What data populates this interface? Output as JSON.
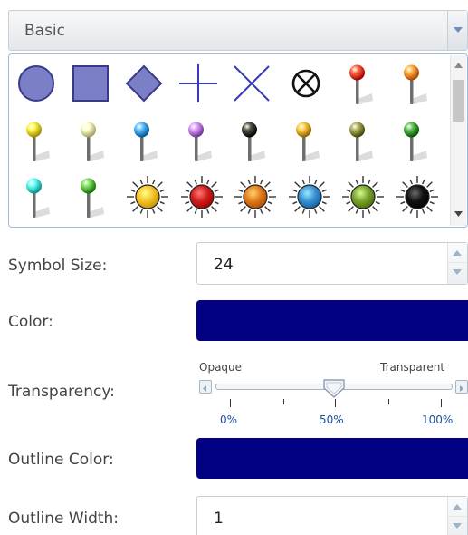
{
  "category": {
    "selected": "Basic"
  },
  "palette": {
    "symbols": [
      {
        "kind": "circle",
        "name": "circle-symbol-icon",
        "color": "#7b7fc6"
      },
      {
        "kind": "square",
        "name": "square-symbol-icon",
        "color": "#7b7fc6"
      },
      {
        "kind": "diamond",
        "name": "diamond-symbol-icon",
        "color": "#7b7fc6"
      },
      {
        "kind": "cross",
        "name": "cross-symbol-icon",
        "color": "#3a3ab8"
      },
      {
        "kind": "x",
        "name": "x-symbol-icon",
        "color": "#3a3ab8"
      },
      {
        "kind": "circlex",
        "name": "circle-x-symbol-icon",
        "color": "#111111"
      },
      {
        "kind": "pin",
        "name": "pushpin-red-icon",
        "color": "#e8401c"
      },
      {
        "kind": "pin",
        "name": "pushpin-orange-icon",
        "color": "#f08a1c"
      },
      {
        "kind": "pin",
        "name": "pushpin-yellow-icon",
        "color": "#e8d020"
      },
      {
        "kind": "pin",
        "name": "pushpin-cream-icon",
        "color": "#e6e6a8"
      },
      {
        "kind": "pin",
        "name": "pushpin-blue-icon",
        "color": "#3a9ad8"
      },
      {
        "kind": "pin",
        "name": "pushpin-violet-icon",
        "color": "#b678d8"
      },
      {
        "kind": "pin",
        "name": "pushpin-black-icon",
        "color": "#2c2c1e"
      },
      {
        "kind": "pin",
        "name": "pushpin-gold-icon",
        "color": "#d8a81c"
      },
      {
        "kind": "pin",
        "name": "pushpin-olive-icon",
        "color": "#8a8a3a"
      },
      {
        "kind": "pin",
        "name": "pushpin-green-icon",
        "color": "#3a9a2a"
      },
      {
        "kind": "pin",
        "name": "pushpin-cyan-icon",
        "color": "#40d8d0"
      },
      {
        "kind": "pin",
        "name": "pushpin-lime-icon",
        "color": "#5ab83a"
      },
      {
        "kind": "sun",
        "name": "sun-yellow-icon",
        "color": "#f5c22a"
      },
      {
        "kind": "sun",
        "name": "sun-red-icon",
        "color": "#d01e1e"
      },
      {
        "kind": "sun",
        "name": "sun-orange-icon",
        "color": "#e07a1a"
      },
      {
        "kind": "sun",
        "name": "sun-blue-icon",
        "color": "#3a90d0"
      },
      {
        "kind": "sun",
        "name": "sun-green-icon",
        "color": "#7aa030"
      },
      {
        "kind": "sun",
        "name": "sun-black-icon",
        "color": "#111111"
      }
    ]
  },
  "symbol_size": {
    "label": "Symbol Size:",
    "value": "24"
  },
  "color": {
    "label": "Color:",
    "value": "#000080"
  },
  "transparency": {
    "label": "Transparency:",
    "min_label": "Opaque",
    "max_label": "Transparent",
    "ticks": [
      "0%",
      "50%",
      "100%"
    ],
    "value_fraction": 0.5
  },
  "outline_color": {
    "label": "Outline Color:",
    "value": "#000080"
  },
  "outline_width": {
    "label": "Outline Width:",
    "value": "1"
  }
}
